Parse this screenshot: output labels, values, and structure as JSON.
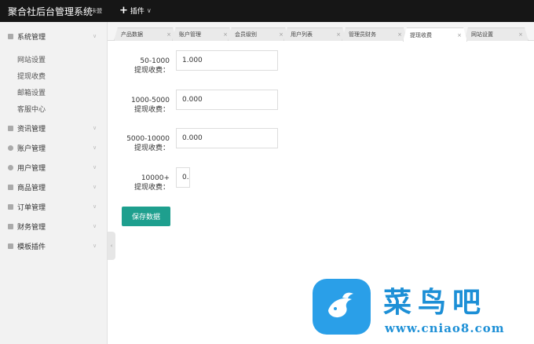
{
  "topbar": {
    "brand": "聚合社后台管理系统",
    "brand_sub": "卡盟",
    "plugin_menu": "插件"
  },
  "sidebar": {
    "sections": [
      {
        "label": "系统管理"
      },
      {
        "label": "资讯管理"
      },
      {
        "label": "账户管理"
      },
      {
        "label": "用户管理"
      },
      {
        "label": "商品管理"
      },
      {
        "label": "订单管理"
      },
      {
        "label": "财务管理"
      },
      {
        "label": "模板插件"
      }
    ],
    "sub_items": [
      "网站设置",
      "提现收费",
      "邮箱设置",
      "客服中心"
    ]
  },
  "tabs": [
    {
      "label": "产品数据",
      "active": false
    },
    {
      "label": "账户管理",
      "active": false
    },
    {
      "label": "会员级别",
      "active": false
    },
    {
      "label": "用户列表",
      "active": false
    },
    {
      "label": "管理员财务",
      "active": false
    },
    {
      "label": "提现收费",
      "active": true
    },
    {
      "label": "网站设置",
      "active": false
    }
  ],
  "form": {
    "rows": [
      {
        "range": "50-1000",
        "label": "提现收费：",
        "value": "1.000"
      },
      {
        "range": "1000-5000",
        "label": "提现收费：",
        "value": "0.000"
      },
      {
        "range": "5000-10000",
        "label": "提现收费：",
        "value": "0.000"
      },
      {
        "range": "10000+",
        "label": "提现收费：",
        "value": "0."
      }
    ],
    "save_label": "保存数据"
  },
  "watermark": {
    "title": "菜鸟吧",
    "url": "www.cniao8.com"
  },
  "colors": {
    "topbar": "#161616",
    "accent": "#1e9f8e",
    "watermark": "#1c8fd6"
  }
}
